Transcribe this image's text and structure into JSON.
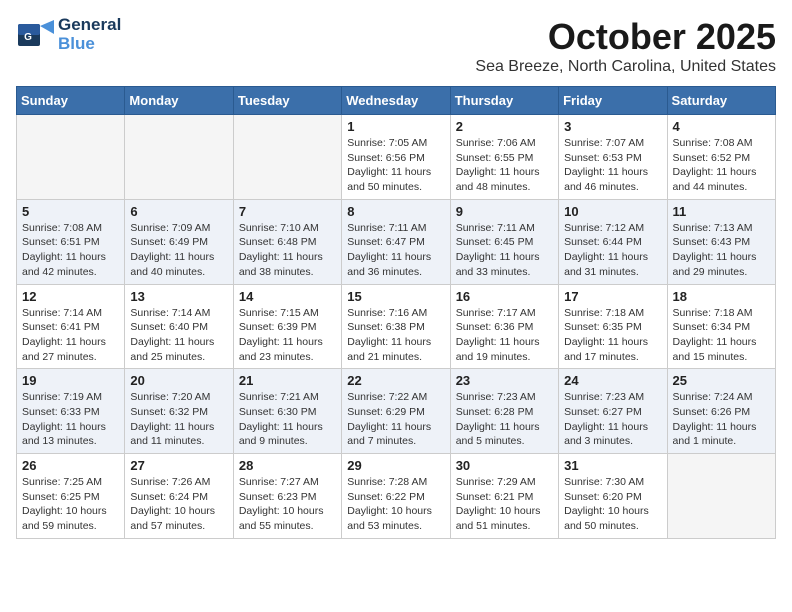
{
  "logo": {
    "line1": "General",
    "line2": "Blue"
  },
  "title": "October 2025",
  "location": "Sea Breeze, North Carolina, United States",
  "weekdays": [
    "Sunday",
    "Monday",
    "Tuesday",
    "Wednesday",
    "Thursday",
    "Friday",
    "Saturday"
  ],
  "weeks": [
    [
      {
        "day": "",
        "info": ""
      },
      {
        "day": "",
        "info": ""
      },
      {
        "day": "",
        "info": ""
      },
      {
        "day": "1",
        "info": "Sunrise: 7:05 AM\nSunset: 6:56 PM\nDaylight: 11 hours\nand 50 minutes."
      },
      {
        "day": "2",
        "info": "Sunrise: 7:06 AM\nSunset: 6:55 PM\nDaylight: 11 hours\nand 48 minutes."
      },
      {
        "day": "3",
        "info": "Sunrise: 7:07 AM\nSunset: 6:53 PM\nDaylight: 11 hours\nand 46 minutes."
      },
      {
        "day": "4",
        "info": "Sunrise: 7:08 AM\nSunset: 6:52 PM\nDaylight: 11 hours\nand 44 minutes."
      }
    ],
    [
      {
        "day": "5",
        "info": "Sunrise: 7:08 AM\nSunset: 6:51 PM\nDaylight: 11 hours\nand 42 minutes."
      },
      {
        "day": "6",
        "info": "Sunrise: 7:09 AM\nSunset: 6:49 PM\nDaylight: 11 hours\nand 40 minutes."
      },
      {
        "day": "7",
        "info": "Sunrise: 7:10 AM\nSunset: 6:48 PM\nDaylight: 11 hours\nand 38 minutes."
      },
      {
        "day": "8",
        "info": "Sunrise: 7:11 AM\nSunset: 6:47 PM\nDaylight: 11 hours\nand 36 minutes."
      },
      {
        "day": "9",
        "info": "Sunrise: 7:11 AM\nSunset: 6:45 PM\nDaylight: 11 hours\nand 33 minutes."
      },
      {
        "day": "10",
        "info": "Sunrise: 7:12 AM\nSunset: 6:44 PM\nDaylight: 11 hours\nand 31 minutes."
      },
      {
        "day": "11",
        "info": "Sunrise: 7:13 AM\nSunset: 6:43 PM\nDaylight: 11 hours\nand 29 minutes."
      }
    ],
    [
      {
        "day": "12",
        "info": "Sunrise: 7:14 AM\nSunset: 6:41 PM\nDaylight: 11 hours\nand 27 minutes."
      },
      {
        "day": "13",
        "info": "Sunrise: 7:14 AM\nSunset: 6:40 PM\nDaylight: 11 hours\nand 25 minutes."
      },
      {
        "day": "14",
        "info": "Sunrise: 7:15 AM\nSunset: 6:39 PM\nDaylight: 11 hours\nand 23 minutes."
      },
      {
        "day": "15",
        "info": "Sunrise: 7:16 AM\nSunset: 6:38 PM\nDaylight: 11 hours\nand 21 minutes."
      },
      {
        "day": "16",
        "info": "Sunrise: 7:17 AM\nSunset: 6:36 PM\nDaylight: 11 hours\nand 19 minutes."
      },
      {
        "day": "17",
        "info": "Sunrise: 7:18 AM\nSunset: 6:35 PM\nDaylight: 11 hours\nand 17 minutes."
      },
      {
        "day": "18",
        "info": "Sunrise: 7:18 AM\nSunset: 6:34 PM\nDaylight: 11 hours\nand 15 minutes."
      }
    ],
    [
      {
        "day": "19",
        "info": "Sunrise: 7:19 AM\nSunset: 6:33 PM\nDaylight: 11 hours\nand 13 minutes."
      },
      {
        "day": "20",
        "info": "Sunrise: 7:20 AM\nSunset: 6:32 PM\nDaylight: 11 hours\nand 11 minutes."
      },
      {
        "day": "21",
        "info": "Sunrise: 7:21 AM\nSunset: 6:30 PM\nDaylight: 11 hours\nand 9 minutes."
      },
      {
        "day": "22",
        "info": "Sunrise: 7:22 AM\nSunset: 6:29 PM\nDaylight: 11 hours\nand 7 minutes."
      },
      {
        "day": "23",
        "info": "Sunrise: 7:23 AM\nSunset: 6:28 PM\nDaylight: 11 hours\nand 5 minutes."
      },
      {
        "day": "24",
        "info": "Sunrise: 7:23 AM\nSunset: 6:27 PM\nDaylight: 11 hours\nand 3 minutes."
      },
      {
        "day": "25",
        "info": "Sunrise: 7:24 AM\nSunset: 6:26 PM\nDaylight: 11 hours\nand 1 minute."
      }
    ],
    [
      {
        "day": "26",
        "info": "Sunrise: 7:25 AM\nSunset: 6:25 PM\nDaylight: 10 hours\nand 59 minutes."
      },
      {
        "day": "27",
        "info": "Sunrise: 7:26 AM\nSunset: 6:24 PM\nDaylight: 10 hours\nand 57 minutes."
      },
      {
        "day": "28",
        "info": "Sunrise: 7:27 AM\nSunset: 6:23 PM\nDaylight: 10 hours\nand 55 minutes."
      },
      {
        "day": "29",
        "info": "Sunrise: 7:28 AM\nSunset: 6:22 PM\nDaylight: 10 hours\nand 53 minutes."
      },
      {
        "day": "30",
        "info": "Sunrise: 7:29 AM\nSunset: 6:21 PM\nDaylight: 10 hours\nand 51 minutes."
      },
      {
        "day": "31",
        "info": "Sunrise: 7:30 AM\nSunset: 6:20 PM\nDaylight: 10 hours\nand 50 minutes."
      },
      {
        "day": "",
        "info": ""
      }
    ]
  ]
}
